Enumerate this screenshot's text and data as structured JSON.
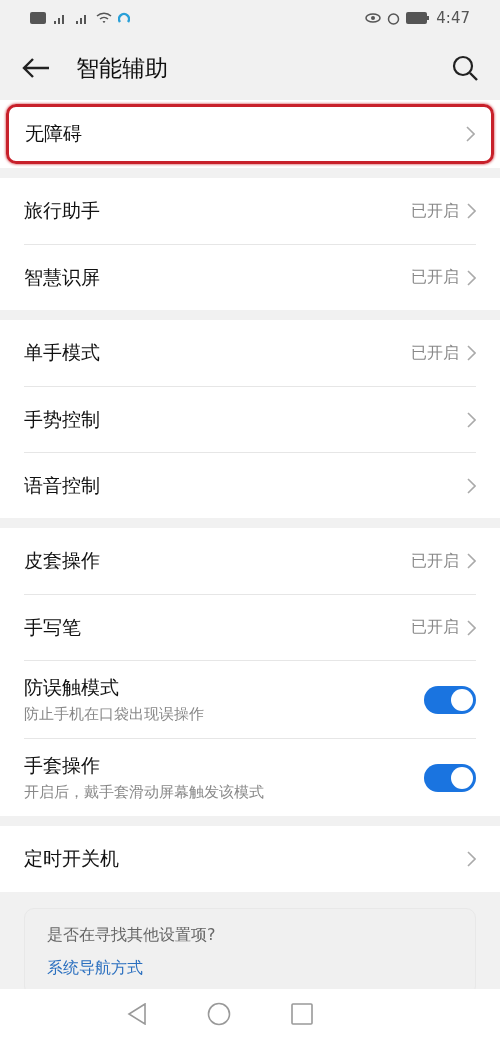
{
  "status_bar": {
    "time": "4:47"
  },
  "header": {
    "title": "智能辅助"
  },
  "sections": [
    {
      "items": [
        {
          "kind": "link",
          "label": "无障碍",
          "highlighted": true
        }
      ]
    },
    {
      "items": [
        {
          "kind": "link",
          "label": "旅行助手",
          "value": "已开启",
          "highlighted": false
        },
        {
          "kind": "link",
          "label": "智慧识屏",
          "value": "已开启",
          "highlighted": false
        }
      ]
    },
    {
      "items": [
        {
          "kind": "link",
          "label": "单手模式",
          "value": "已开启",
          "highlighted": false
        },
        {
          "kind": "link",
          "label": "手势控制",
          "highlighted": false
        },
        {
          "kind": "link",
          "label": "语音控制",
          "highlighted": false
        }
      ]
    },
    {
      "items": [
        {
          "kind": "link",
          "label": "皮套操作",
          "value": "已开启",
          "highlighted": false
        },
        {
          "kind": "link",
          "label": "手写笔",
          "value": "已开启",
          "highlighted": false
        },
        {
          "kind": "toggle",
          "label": "防误触模式",
          "subtitle": "防止手机在口袋出现误操作",
          "on": true
        },
        {
          "kind": "toggle",
          "label": "手套操作",
          "subtitle": "开启后，戴手套滑动屏幕触发该模式",
          "on": true
        }
      ]
    },
    {
      "items": [
        {
          "kind": "link",
          "label": "定时开关机",
          "highlighted": false
        }
      ]
    }
  ],
  "suggestion": {
    "title": "是否在寻找其他设置项?",
    "link": "系统导航方式"
  }
}
